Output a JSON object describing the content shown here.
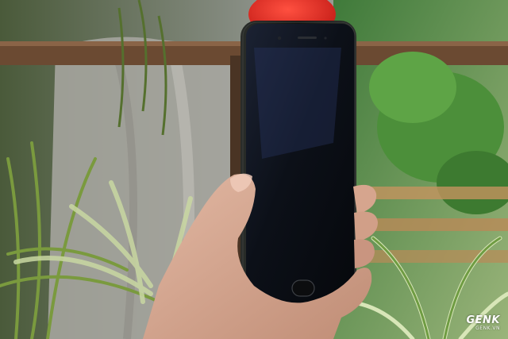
{
  "watermark": {
    "brand": "GENK",
    "domain": "GENK.VN"
  }
}
